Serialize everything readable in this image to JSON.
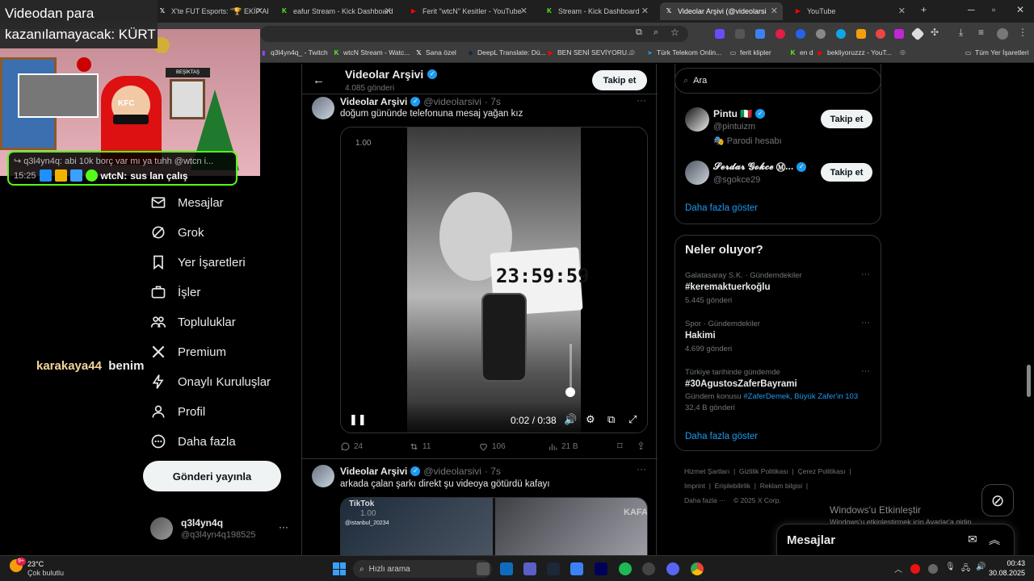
{
  "browser": {
    "tabs": [
      {
        "label": "X'te FUT Esports: \"🏆 EKİP ARK",
        "icon": "x-icon",
        "color": "#fff"
      },
      {
        "label": "eafur Stream - Kick Dashboard",
        "icon": "kick-icon",
        "color": "#53fc18"
      },
      {
        "label": "Ferit \"wtcN\" Kesitler - YouTube",
        "icon": "youtube-icon",
        "color": "#ff0000"
      },
      {
        "label": "Stream - Kick Dashboard",
        "icon": "kick-icon",
        "color": "#53fc18"
      },
      {
        "label": "Videolar Arşivi (@videolarsi",
        "icon": "x-icon",
        "color": "#fff"
      },
      {
        "label": "YouTube",
        "icon": "youtube-icon",
        "color": "#ff0000"
      }
    ],
    "new_tab": "+",
    "bookmarks": [
      {
        "label": "q3l4yn4q_ - Twitch",
        "icon": "twitch-icon",
        "color": "#9146ff"
      },
      {
        "label": "wtcN Stream - Watc...",
        "icon": "kick-icon",
        "color": "#53fc18"
      },
      {
        "label": "Sana özel",
        "icon": "x-icon",
        "color": "#fff"
      },
      {
        "label": "DeepL Translate: Dü...",
        "icon": "deepl-icon",
        "color": "#0f2b46"
      },
      {
        "label": "BEN SENİ SEVİYORU...",
        "icon": "youtube-icon",
        "color": "#ff0000"
      },
      {
        "label": "",
        "icon": "globe-icon",
        "color": "#aaa"
      },
      {
        "label": "Türk Telekom Onlin...",
        "icon": "telekom-icon",
        "color": "#1d9bf0"
      },
      {
        "label": "ferit klipler",
        "icon": "folder-icon",
        "color": "#ccc"
      },
      {
        "label": "en d",
        "icon": "kick-icon",
        "color": "#53fc18"
      },
      {
        "label": "bekliyoruzzz - YouT...",
        "icon": "youtube-icon",
        "color": "#ff0000"
      },
      {
        "label": "",
        "icon": "globe-icon",
        "color": "#aaa"
      }
    ],
    "all_bookmarks": "Tüm Yer İşaretleri"
  },
  "overlay": {
    "title_line1": "Videodan para",
    "title_line2": "kazanılamayacak: KÜRT",
    "chat_line1": "q3l4yn4q: abi 10k borç var mı ya tuhh @wtcn i...",
    "chat_time": "15:25",
    "chat_user": "wtcN:",
    "chat_msg": "sus lan çalış",
    "webcam_sign": "BEŞİKTAŞ",
    "webcam_shirt": "KFC",
    "donation_name": "karakaya44",
    "donation_msg": "benim"
  },
  "sidebar": {
    "items": [
      {
        "label": "Mesajlar",
        "icon": "mail-icon"
      },
      {
        "label": "Grok",
        "icon": "grok-icon"
      },
      {
        "label": "Yer İşaretleri",
        "icon": "bookmark-icon"
      },
      {
        "label": "İşler",
        "icon": "briefcase-icon"
      },
      {
        "label": "Topluluklar",
        "icon": "people-icon"
      },
      {
        "label": "Premium",
        "icon": "x-logo-icon"
      },
      {
        "label": "Onaylı Kuruluşlar",
        "icon": "bolt-icon"
      },
      {
        "label": "Profil",
        "icon": "person-icon"
      },
      {
        "label": "Daha fazla",
        "icon": "more-circle-icon"
      }
    ],
    "post_button": "Gönderi yayınla",
    "account_name": "q3l4yn4q",
    "account_handle": "@q3l4yn4q198525",
    "account_more": "···"
  },
  "profile_header": {
    "name": "Videolar Arşivi",
    "posts_count": "4.085 gönderi",
    "follow_button": "Takip et"
  },
  "posts": [
    {
      "name": "Videolar Arşivi",
      "handle": "@videolarsivi",
      "time": "· 7s",
      "text": "doğum gününde telefonuna mesaj yağan kız",
      "video_overlay_num": "1.00",
      "video_clock": "23:59:59",
      "video_time": "0:02 / 0:38",
      "replies": "24",
      "retweets": "11",
      "likes": "106",
      "views": "21 B"
    },
    {
      "name": "Videolar Arşivi",
      "handle": "@videolarsivi",
      "time": "· 7s",
      "text": "arkada çalan şarkı direkt şu videoya götürdü kafayı",
      "video_overlay_num": "1.00",
      "tiktok": "TikTok",
      "tiktok_user": "@istanbul_20234",
      "brand": "KAFA"
    }
  ],
  "right": {
    "search_placeholder": "Ara",
    "who_to_follow": [
      {
        "name": "Pintu 🇮🇹",
        "handle": "@pintuizm",
        "extra": "🎭 Parodi hesabı",
        "follow": "Takip et"
      },
      {
        "name": "𝓢𝓮𝓻𝓭𝓪𝓻 𝓖𝓸𝓴𝓬𝓮 Ⓜ...",
        "handle": "@sgokce29",
        "extra": "",
        "follow": "Takip et"
      }
    ],
    "show_more": "Daha fazla göster",
    "trends_title": "Neler oluyor?",
    "trends": [
      {
        "meta": "Galatasaray S.K. · Gündemdekiler",
        "name": "#keremaktuerkoğlu",
        "count": "5.445 gönderi",
        "extra": ""
      },
      {
        "meta": "Spor · Gündemdekiler",
        "name": "Hakimi",
        "count": "4.699 gönderi",
        "extra": ""
      },
      {
        "meta": "Türkiye tarihinde gündemde",
        "name": "#30AgustosZaferBayrami",
        "count": "32,4 B gönderi",
        "extra_prefix": "Gündem konusu",
        "extra": "#ZaferDemek, Büyük Zafer'in 103"
      }
    ],
    "trends_more": "Daha fazla göster",
    "footer": [
      "Hizmet Şartları",
      "Gizlilik Politikası",
      "Çerez Politikası",
      "Imprint",
      "Erişilebilirlik",
      "Reklam bilgisi",
      "Daha fazla ···",
      "© 2025 X Corp."
    ],
    "messages_title": "Mesajlar",
    "activate_title": "Windows'u Etkinleştir",
    "activate_sub": "Windows'u etkinleştirmek için Ayarlar'a gidin."
  },
  "taskbar": {
    "weather_temp": "23°C",
    "weather_desc": "Çok bulutlu",
    "weather_badge": "9+",
    "search_placeholder": "Hızlı arama",
    "clock_time": "00:43",
    "clock_date": "30.08.2025"
  }
}
